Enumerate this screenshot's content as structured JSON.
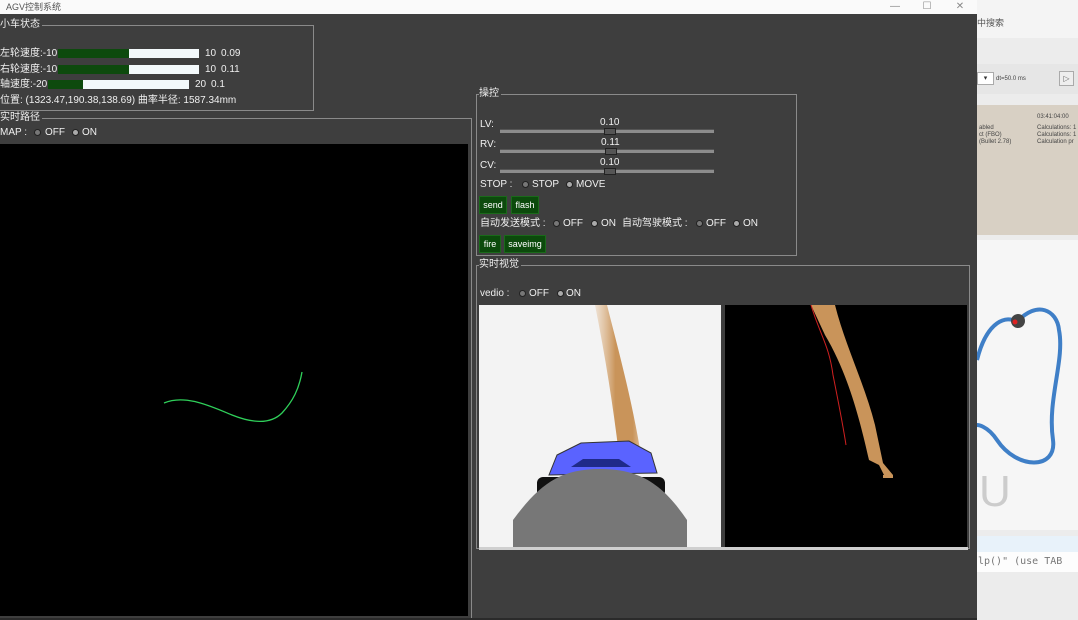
{
  "window": {
    "title": "AGV控制系统",
    "min_glyph": "—",
    "max_glyph": "☐",
    "close_glyph": "✕"
  },
  "status_group": {
    "title": "小车状态",
    "rows": [
      {
        "label": "左轮速度:-10",
        "max": "10",
        "value": "0.09",
        "fill_fraction": 0.5
      },
      {
        "label": "右轮速度:-10",
        "max": "10",
        "value": "0.11",
        "fill_fraction": 0.5
      },
      {
        "label": "轴速度:-20",
        "max": "20",
        "value": "0.1",
        "fill_fraction": 0.25
      }
    ],
    "position_text": "位置:  (1323.47,190.38,138.69)   曲率半径:   1587.34mm"
  },
  "path_group": {
    "title": "实时路径",
    "map_label": "MAP :",
    "off_label": "OFF",
    "on_label": "ON",
    "selected": "ON"
  },
  "control_group": {
    "title": "操控",
    "sliders": [
      {
        "label": "LV:",
        "value": "0.10"
      },
      {
        "label": "RV:",
        "value": "0.11"
      },
      {
        "label": "CV:",
        "value": "0.10"
      }
    ],
    "stop_label": "STOP :",
    "stop_option": "STOP",
    "move_option": "MOVE",
    "send_button": "send",
    "flash_button": "flash",
    "auto_send_label": "自动发送模式 :",
    "auto_drive_label": "自动驾驶模式 :",
    "off_label": "OFF",
    "on_label": "ON",
    "fire_button": "fire",
    "saveimg_button": "saveimg"
  },
  "vision_group": {
    "title": "实时视觉",
    "video_label": "vedio :",
    "off_label": "OFF",
    "on_label": "ON"
  },
  "background_app": {
    "search_text": "中搜索",
    "dropdown_text": "dt=50.0 ms",
    "sim_time_text": "03:41:04:00",
    "console_text": "lp()\" (use TAB",
    "letter_u": "U",
    "sim_stats": [
      "Calculations: 1",
      "Calculations: 1",
      "Calculation pr"
    ],
    "side_labels": [
      "abled",
      "ct (FBO)",
      "(Bullet 2.78)"
    ]
  },
  "colors": {
    "accent_green": "#0c4a0c",
    "path_line": "#2fd05a",
    "track_tan": "#c9945a",
    "robot_blue": "#5a63ff"
  }
}
